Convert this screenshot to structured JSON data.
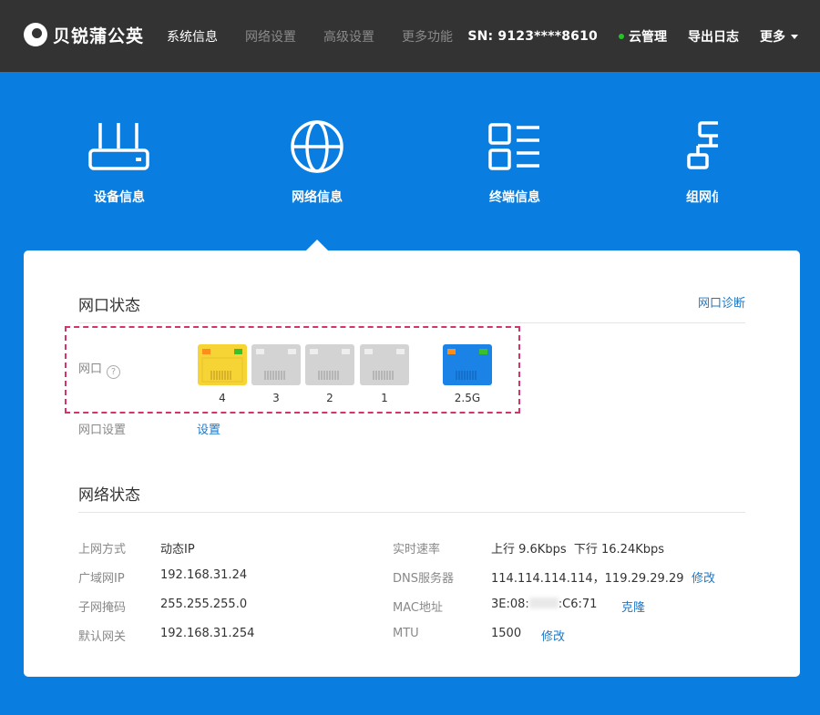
{
  "header": {
    "brand": "贝锐蒲公英",
    "nav": [
      "系统信息",
      "网络设置",
      "高级设置",
      "更多功能"
    ],
    "sn": "SN: 9123****8610",
    "cloud_label": "云管理",
    "export_label": "导出日志",
    "more_label": "更多"
  },
  "features": [
    {
      "label": "设备信息",
      "icon": "router-icon"
    },
    {
      "label": "网络信息",
      "icon": "globe-icon"
    },
    {
      "label": "终端信息",
      "icon": "list-icon"
    },
    {
      "label": "组网信息",
      "icon": "network-icon"
    }
  ],
  "port_status": {
    "title": "网口状态",
    "diag_link": "网口诊断",
    "port_label": "网口",
    "help": "?",
    "ports": [
      {
        "name": "4",
        "color": "#f7d436"
      },
      {
        "name": "3",
        "color": "#d3d3d3"
      },
      {
        "name": "2",
        "color": "#d3d3d3"
      },
      {
        "name": "1",
        "color": "#d3d3d3"
      },
      {
        "name": "2.5G",
        "color": "#1b82e6"
      }
    ],
    "setting_label": "网口设置",
    "setting_link": "设置"
  },
  "network_status": {
    "title": "网络状态",
    "left": [
      {
        "label": "上网方式",
        "value": "动态IP"
      },
      {
        "label": "广域网IP",
        "value": "192.168.31.24"
      },
      {
        "label": "子网掩码",
        "value": "255.255.255.0"
      },
      {
        "label": "默认网关",
        "value": "192.168.31.254"
      }
    ],
    "speed": {
      "label": "实时速率",
      "value": "上行 9.6Kbps  下行 16.24Kbps"
    },
    "dns": {
      "label": "DNS服务器",
      "value": "114.114.114.114，119.29.29.29",
      "action": "修改"
    },
    "mac": {
      "label": "MAC地址",
      "prefix": "3E:08:",
      "suffix": ":C6:71",
      "action": "克隆"
    },
    "mtu": {
      "label": "MTU",
      "value": "1500",
      "action": "修改"
    }
  },
  "colors": {
    "accent": "#0a7de0",
    "link": "#1b78c8",
    "topbar": "#333333",
    "highlight": "#d6336c"
  }
}
